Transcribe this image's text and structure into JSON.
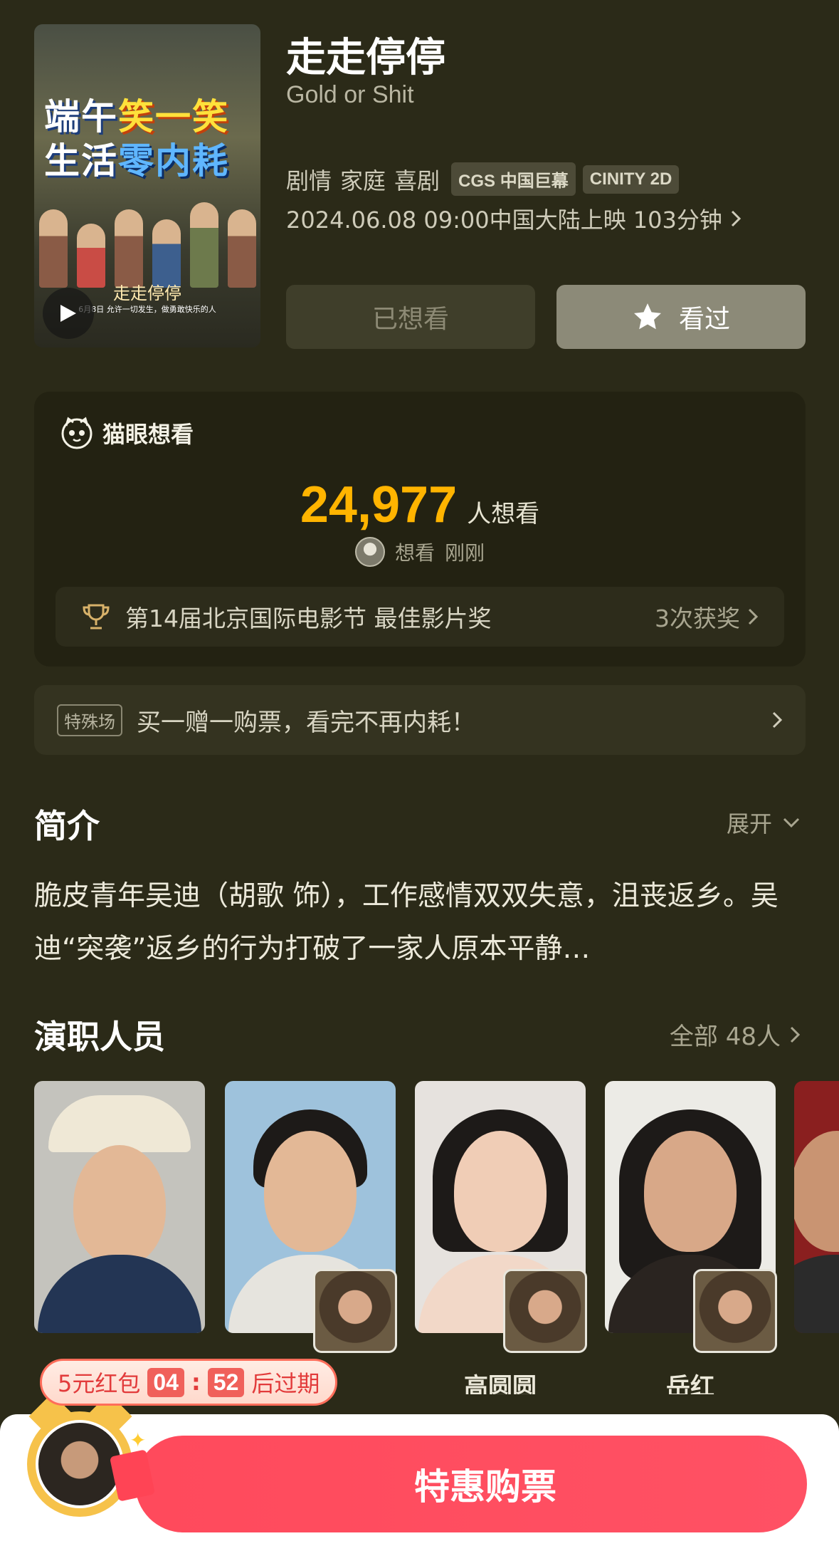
{
  "movie": {
    "title": "走走停停",
    "subtitle": "Gold or Shit",
    "genres": [
      "剧情",
      "家庭",
      "喜剧"
    ],
    "formats": [
      "CGS 中国巨幕",
      "CINITY 2D"
    ],
    "release": "2024.06.08 09:00中国大陆上映 103分钟",
    "poster": {
      "line1_a": "端午",
      "line1_b": "笑一笑",
      "line2_a": "生活",
      "line2_b": "零内耗",
      "logo": "走走停停",
      "tagline": "6月8日 允许一切发生，做勇敢快乐的人"
    }
  },
  "actions": {
    "want_label": "已想看",
    "seen_label": "看过"
  },
  "maoyan": {
    "header": "猫眼想看",
    "count": "24,977",
    "unit": "人想看",
    "activity_action": "想看",
    "activity_time": "刚刚",
    "award_text": "第14届北京国际电影节 最佳影片奖",
    "award_count": "3次获奖"
  },
  "promo": {
    "tag": "特殊场",
    "text": "买一赠一购票，看完不再内耗！"
  },
  "intro": {
    "title": "简介",
    "expand_label": "展开",
    "text": "脆皮青年吴迪（胡歌 饰），工作感情双双失意，沮丧返乡。吴迪“突袭”返乡的行为打破了一家人原本平静…"
  },
  "cast": {
    "title": "演职人员",
    "all_label": "全部 48人",
    "members": [
      {
        "name": ""
      },
      {
        "name": ""
      },
      {
        "name": "高圆圆"
      },
      {
        "name": "岳红"
      }
    ]
  },
  "redpacket": {
    "label": "5元红包",
    "minutes": "04",
    "seconds": "52",
    "suffix": "后过期"
  },
  "buy": {
    "label": "特惠购票"
  },
  "colors": {
    "background": "#2b2a18",
    "accent_orange": "#ffb400",
    "buy_red": "#ff4a5c"
  }
}
